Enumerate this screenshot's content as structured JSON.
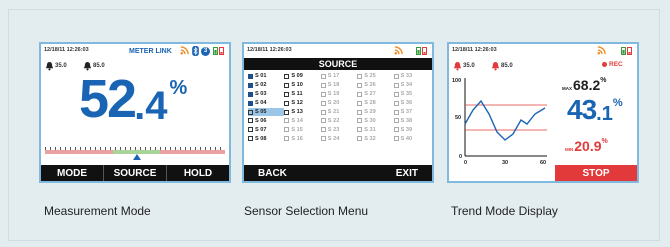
{
  "screens": {
    "measurement": {
      "datetime": "12/18/11 12:26:03",
      "brand": "METER LINK",
      "alarm_low": "35.0",
      "alarm_high": "85.0",
      "reading_int": "52",
      "reading_dec": ".4",
      "unit": "%",
      "softkeys": [
        "MODE",
        "SOURCE",
        "HOLD"
      ],
      "caption": "Measurement Mode"
    },
    "source": {
      "datetime": "12/18/11 12:26:03",
      "title": "SOURCE",
      "sensors": [
        {
          "label": "S 01",
          "checked": true,
          "dim": false
        },
        {
          "label": "S 09",
          "checked": false,
          "dim": false
        },
        {
          "label": "S 17",
          "checked": false,
          "dim": true
        },
        {
          "label": "S 25",
          "checked": false,
          "dim": true
        },
        {
          "label": "S 33",
          "checked": false,
          "dim": true
        },
        {
          "label": "S 02",
          "checked": true,
          "dim": false
        },
        {
          "label": "S 10",
          "checked": false,
          "dim": false
        },
        {
          "label": "S 18",
          "checked": false,
          "dim": true
        },
        {
          "label": "S 26",
          "checked": false,
          "dim": true
        },
        {
          "label": "S 34",
          "checked": false,
          "dim": true
        },
        {
          "label": "S 03",
          "checked": true,
          "dim": false
        },
        {
          "label": "S 11",
          "checked": false,
          "dim": false
        },
        {
          "label": "S 19",
          "checked": false,
          "dim": true
        },
        {
          "label": "S 27",
          "checked": false,
          "dim": true
        },
        {
          "label": "S 35",
          "checked": false,
          "dim": true
        },
        {
          "label": "S 04",
          "checked": true,
          "dim": false
        },
        {
          "label": "S 12",
          "checked": false,
          "dim": false
        },
        {
          "label": "S 20",
          "checked": false,
          "dim": true
        },
        {
          "label": "S 28",
          "checked": false,
          "dim": true
        },
        {
          "label": "S 36",
          "checked": false,
          "dim": true
        },
        {
          "label": "S 05",
          "checked": false,
          "dim": false,
          "highlight": true
        },
        {
          "label": "S 13",
          "checked": false,
          "dim": false
        },
        {
          "label": "S 21",
          "checked": false,
          "dim": true
        },
        {
          "label": "S 29",
          "checked": false,
          "dim": true
        },
        {
          "label": "S 37",
          "checked": false,
          "dim": true
        },
        {
          "label": "S 06",
          "checked": false,
          "dim": false
        },
        {
          "label": "S 14",
          "checked": false,
          "dim": true
        },
        {
          "label": "S 22",
          "checked": false,
          "dim": true
        },
        {
          "label": "S 30",
          "checked": false,
          "dim": true
        },
        {
          "label": "S 38",
          "checked": false,
          "dim": true
        },
        {
          "label": "S 07",
          "checked": false,
          "dim": false
        },
        {
          "label": "S 15",
          "checked": false,
          "dim": true
        },
        {
          "label": "S 23",
          "checked": false,
          "dim": true
        },
        {
          "label": "S 31",
          "checked": false,
          "dim": true
        },
        {
          "label": "S 39",
          "checked": false,
          "dim": true
        },
        {
          "label": "S 08",
          "checked": false,
          "dim": false
        },
        {
          "label": "S 16",
          "checked": false,
          "dim": true
        },
        {
          "label": "S 24",
          "checked": false,
          "dim": true
        },
        {
          "label": "S 32",
          "checked": false,
          "dim": true
        },
        {
          "label": "S 40",
          "checked": false,
          "dim": true
        }
      ],
      "softkeys": [
        "BACK",
        "EXIT"
      ],
      "caption": "Sensor Selection Menu"
    },
    "trend": {
      "datetime": "12/18/11 12:26:03",
      "alarm_low": "35.0",
      "alarm_high": "85.0",
      "rec_label": "REC",
      "max_label": "MAX",
      "max_value": "68.2",
      "max_unit": "%",
      "current_int": "43",
      "current_dec": ".1",
      "current_unit": "%",
      "min_label": "MIN",
      "min_value": "20.9",
      "min_unit": "%",
      "y_ticks": [
        "100",
        "50",
        "0"
      ],
      "x_ticks": [
        "0",
        "30",
        "60"
      ],
      "softkey": "STOP",
      "caption": "Trend Mode Display"
    }
  },
  "colors": {
    "accent_blue": "#1a64b4",
    "alarm_red": "#e23a3a",
    "softkey_black": "#111111",
    "screen_border": "#7fb9de"
  },
  "icons": [
    "bell-icon",
    "rss-icon",
    "bluetooth-icon",
    "battery-icon"
  ]
}
